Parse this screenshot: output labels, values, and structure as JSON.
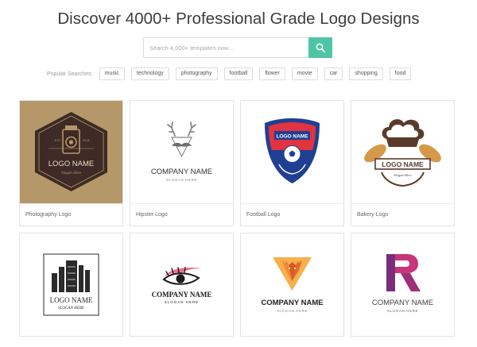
{
  "page": {
    "headline": "Discover 4000+ Professional Grade Logo Designs"
  },
  "search": {
    "placeholder": "Search 4,000+ templates now...",
    "button_icon": "search-icon"
  },
  "popular": {
    "label": "Popular Searches:",
    "tags": [
      "music",
      "technology",
      "photography",
      "football",
      "flower",
      "movie",
      "car",
      "shopping",
      "food"
    ]
  },
  "colors": {
    "accent": "#4ec5a6",
    "photo_bg": "#b4986a",
    "photo_badge": "#3e2a26",
    "football_blue": "#1f3f93",
    "football_red": "#e23340",
    "bakery_brown": "#5a3a2a",
    "bread": "#d49a4a",
    "eye_pink": "#ef6e8a",
    "fox_orange": "#f08a32",
    "r_purple": "#7a2e7a",
    "r_pink": "#c9357a"
  },
  "cards": [
    {
      "caption": "Photography Logo",
      "icon": "camera-badge-icon",
      "logo_name": "LOGO NAME",
      "slogan": "Slogan Here",
      "est": "EST",
      "year": "2021"
    },
    {
      "caption": "Hipster Logo",
      "icon": "antler-mustache-icon",
      "company": "COMPANY NAME",
      "slogan": "SLOGAN HERE"
    },
    {
      "caption": "Football Logo",
      "icon": "soccer-shield-icon",
      "logo_name": "LOGO NAME"
    },
    {
      "caption": "Bakery Logo",
      "icon": "chef-hat-bread-icon",
      "logo_name": "LOGO NAME",
      "slogan": "Slogan Here"
    },
    {
      "caption": "",
      "icon": "building-icon",
      "logo_name": "LOGO NAME",
      "slogan": "SLOGAN HERE"
    },
    {
      "caption": "",
      "icon": "eye-lash-icon",
      "company": "COMPANY NAME",
      "slogan": "SLOGAN HERE"
    },
    {
      "caption": "",
      "icon": "fox-triangle-icon",
      "company": "COMPANY NAME",
      "slogan": "SLOGAN HERE"
    },
    {
      "caption": "",
      "icon": "letter-r-icon",
      "letter": "R",
      "company": "COMPANY NAME",
      "slogan": "SLOGAN HERE"
    }
  ]
}
